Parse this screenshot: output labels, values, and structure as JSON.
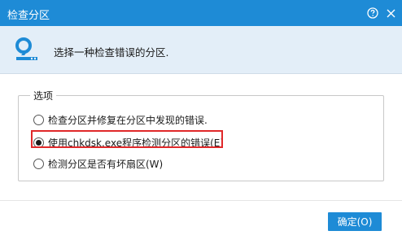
{
  "window": {
    "title": "检查分区",
    "help_icon": "help-circle-icon",
    "close_icon": "close-icon"
  },
  "header": {
    "icon": "search-icon",
    "text": "选择一种检查错误的分区."
  },
  "options_group": {
    "legend": "选项",
    "options": [
      {
        "label": "检查分区并修复在分区中发现的错误.",
        "selected": false
      },
      {
        "label": "使用chkdsk.exe程序检测分区的错误(E)",
        "selected": true
      },
      {
        "label": "检测分区是否有坏扇区(W)",
        "selected": false
      }
    ]
  },
  "footer": {
    "ok_label": "确定(O)"
  },
  "colors": {
    "title_bar": "#1e8bd6",
    "header_bg": "#e3eef8",
    "highlight_border": "#e0282a",
    "ok_button": "#1e8bd6"
  }
}
